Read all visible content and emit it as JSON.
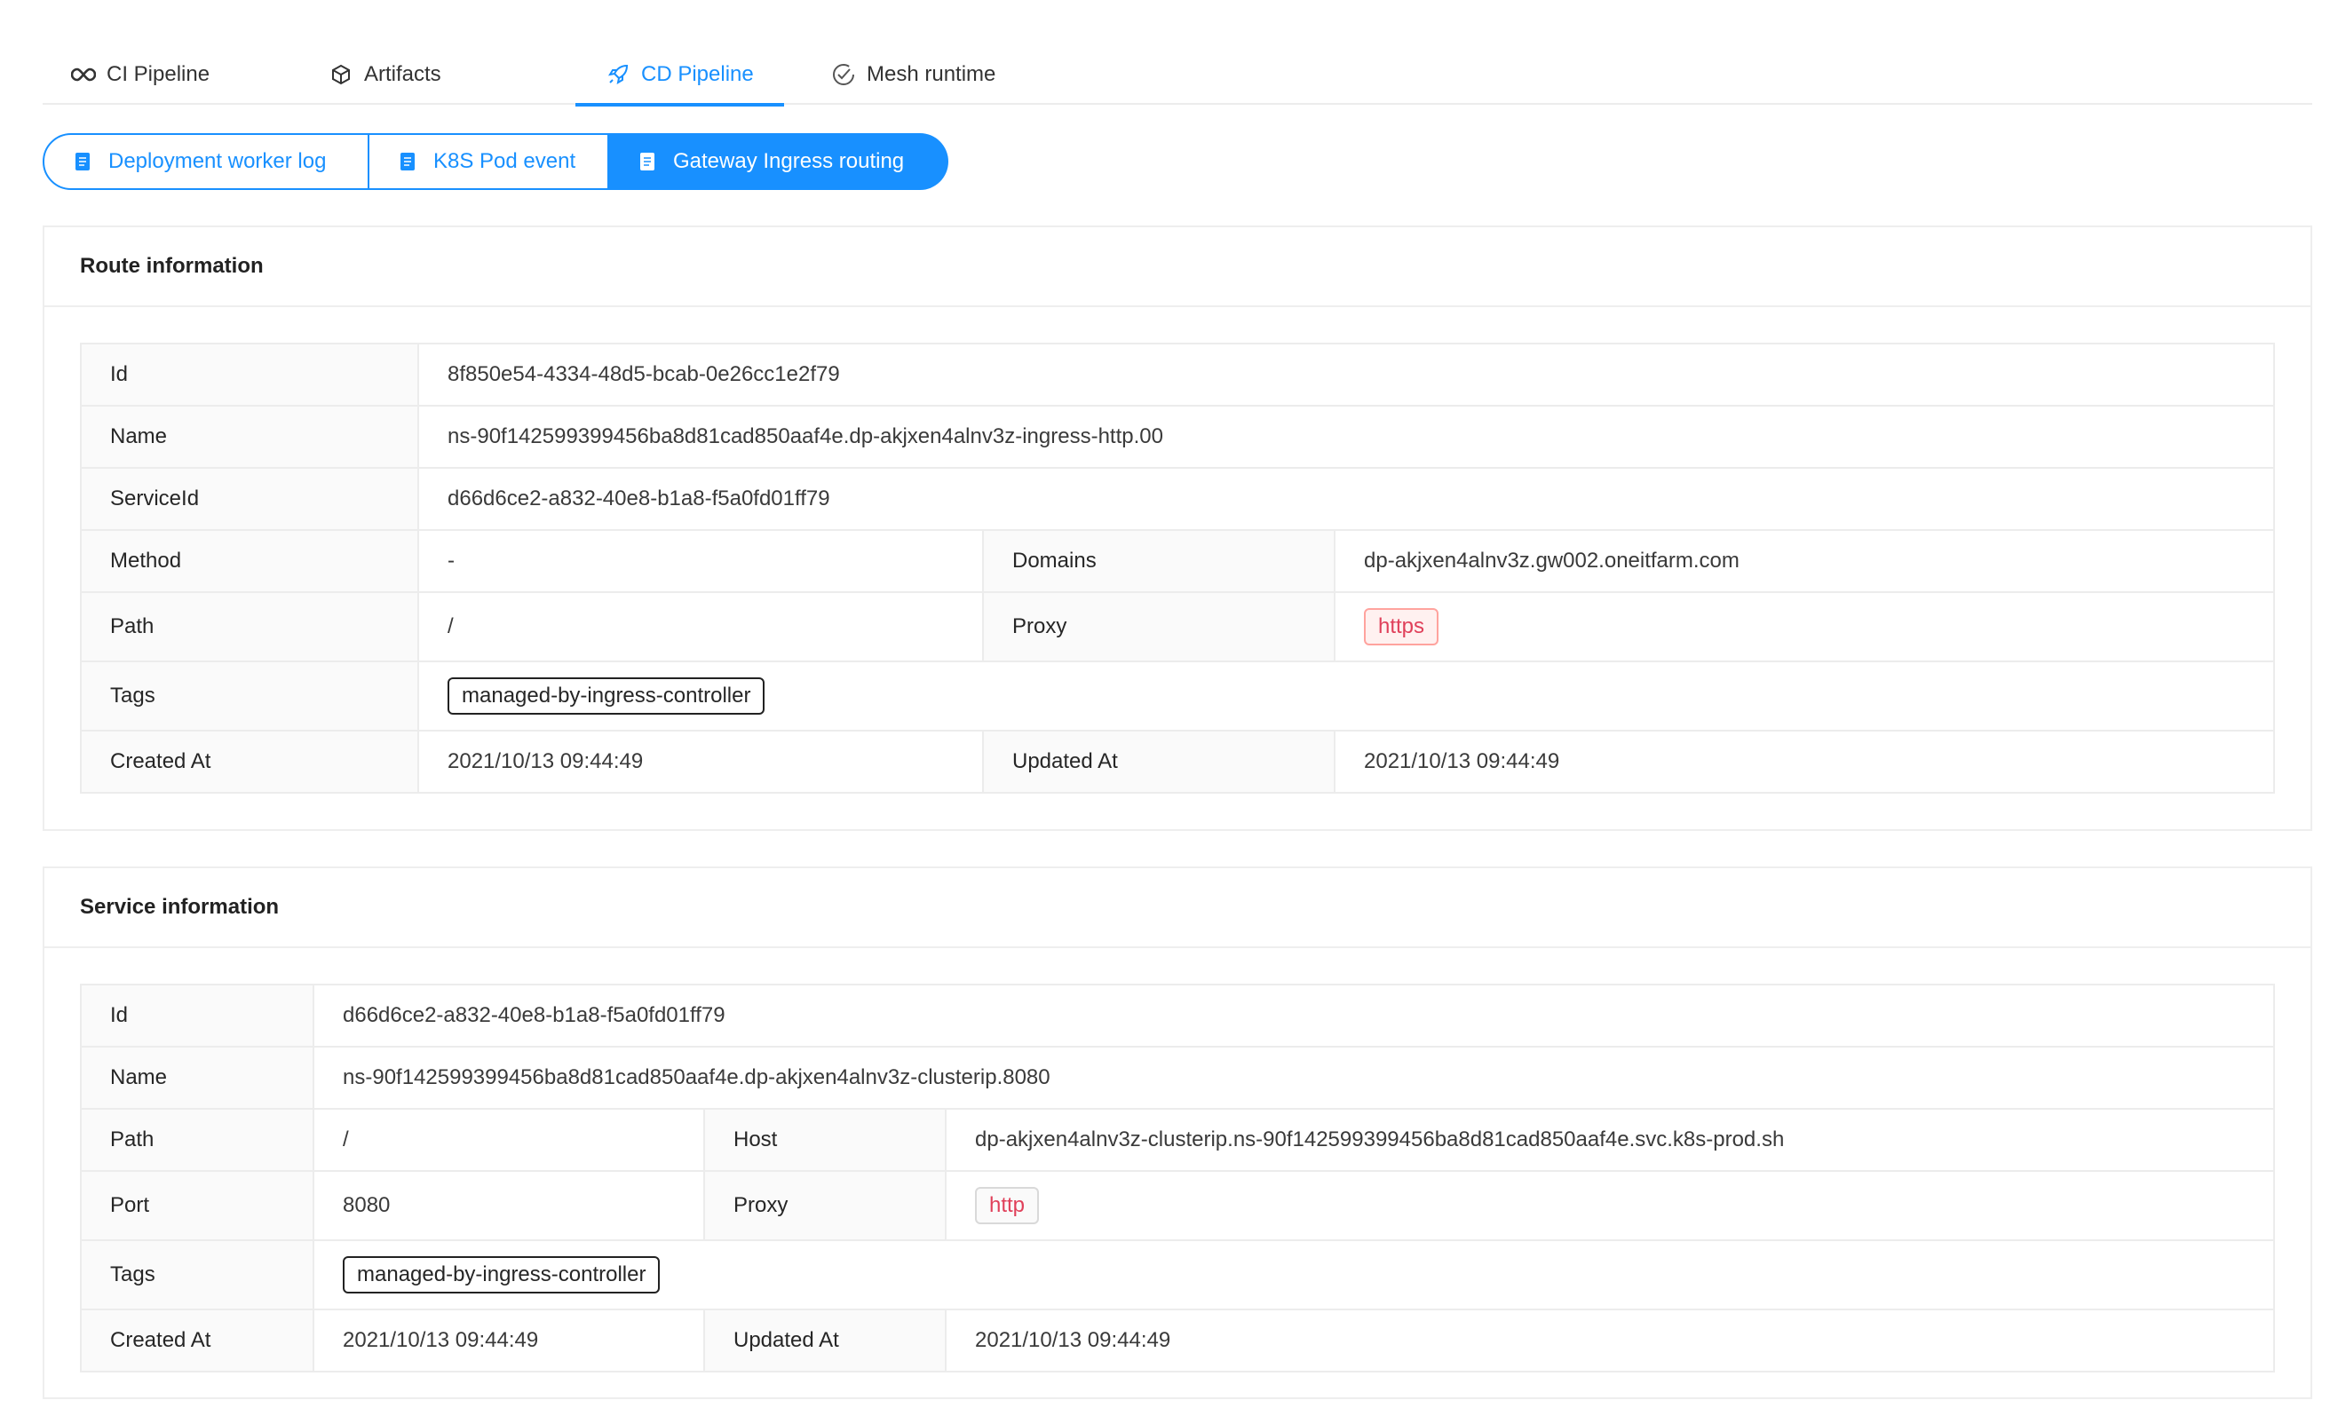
{
  "tabs": [
    {
      "label": "CI Pipeline",
      "icon": "infinity-icon"
    },
    {
      "label": "Artifacts",
      "icon": "cube-icon"
    },
    {
      "label": "CD Pipeline",
      "icon": "rocket-icon"
    },
    {
      "label": "Mesh runtime",
      "icon": "check-circle-icon"
    }
  ],
  "active_tab": "CD Pipeline",
  "segments": [
    {
      "label": "Deployment worker log",
      "icon": "document-icon"
    },
    {
      "label": "K8S Pod event",
      "icon": "document-icon"
    },
    {
      "label": "Gateway Ingress routing",
      "icon": "document-icon"
    }
  ],
  "active_segment": "Gateway Ingress routing",
  "route": {
    "title": "Route information",
    "id_label": "Id",
    "id": "8f850e54-4334-48d5-bcab-0e26cc1e2f79",
    "name_label": "Name",
    "name": "ns-90f142599399456ba8d81cad850aaf4e.dp-akjxen4alnv3z-ingress-http.00",
    "service_id_label": "ServiceId",
    "service_id": "d66d6ce2-a832-40e8-b1a8-f5a0fd01ff79",
    "method_label": "Method",
    "method": "-",
    "domains_label": "Domains",
    "domains": "dp-akjxen4alnv3z.gw002.oneitfarm.com",
    "path_label": "Path",
    "path": "/",
    "proxy_label": "Proxy",
    "proxy": "https",
    "tags_label": "Tags",
    "tag": "managed-by-ingress-controller",
    "created_label": "Created At",
    "created": "2021/10/13 09:44:49",
    "updated_label": "Updated At",
    "updated": "2021/10/13 09:44:49"
  },
  "service": {
    "title": "Service information",
    "id_label": "Id",
    "id": "d66d6ce2-a832-40e8-b1a8-f5a0fd01ff79",
    "name_label": "Name",
    "name": "ns-90f142599399456ba8d81cad850aaf4e.dp-akjxen4alnv3z-clusterip.8080",
    "path_label": "Path",
    "path": "/",
    "host_label": "Host",
    "host": "dp-akjxen4alnv3z-clusterip.ns-90f142599399456ba8d81cad850aaf4e.svc.k8s-prod.sh",
    "port_label": "Port",
    "port": "8080",
    "proxy_label": "Proxy",
    "proxy": "http",
    "tags_label": "Tags",
    "tag": "managed-by-ingress-controller",
    "created_label": "Created At",
    "created": "2021/10/13 09:44:49",
    "updated_label": "Updated At",
    "updated": "2021/10/13 09:44:49"
  },
  "colors": {
    "accent": "#1890ff",
    "proxy_tag": "#e0405a"
  }
}
